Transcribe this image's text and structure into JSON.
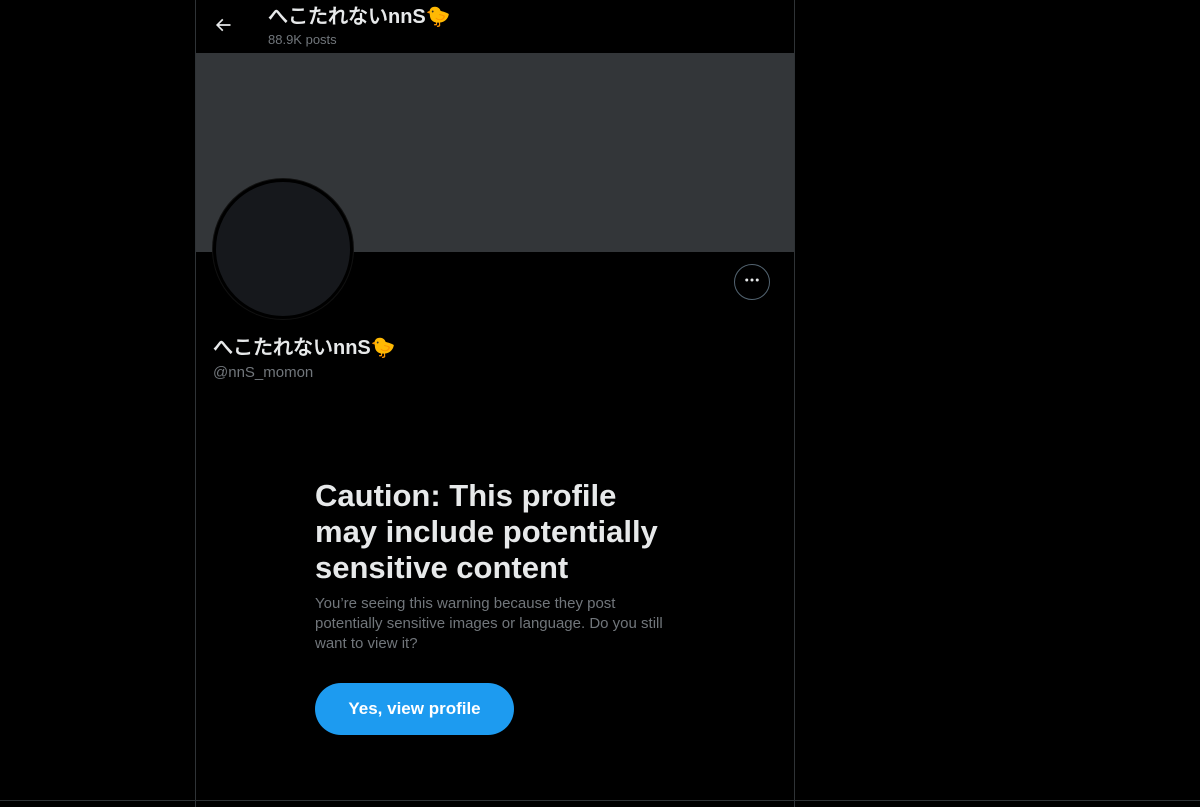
{
  "header": {
    "title": "へこたれないnnS🐤",
    "post_count": "88.9K posts",
    "back_icon": "arrow-left-icon"
  },
  "profile": {
    "display_name": "へこたれないnnS🐤",
    "handle": "@nnS_momon",
    "more_icon": "ellipsis-icon"
  },
  "warning": {
    "title": "Caution: This profile may include potentially sensitive content",
    "text": "You’re seeing this warning because they post potentially sensitive images or language. Do you still want to view it?",
    "button_label": "Yes, view profile"
  },
  "colors": {
    "background": "#000000",
    "banner": "#333639",
    "accent": "#1d9bf0",
    "text_primary": "#e7e9ea",
    "text_secondary": "#71767b",
    "border": "#2f3336"
  }
}
